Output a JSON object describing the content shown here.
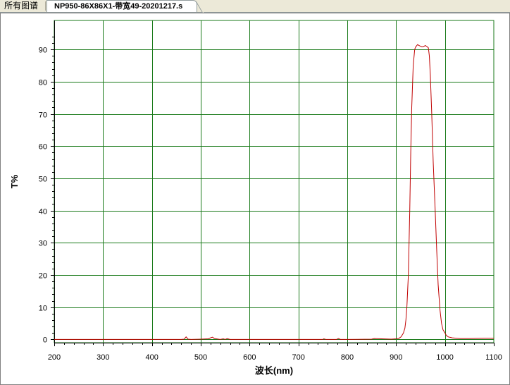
{
  "tabs": {
    "all_spectra": "所有图谱",
    "current_file": "NP950-86X86X1-带宽49-20201217.s"
  },
  "colors": {
    "plot_bg": "#ffffff",
    "grid": "#1a7a1a",
    "curve": "#c00000"
  },
  "chart_data": {
    "type": "line",
    "xlabel": "波长(nm)",
    "ylabel": "T%",
    "xlim": [
      200,
      1100
    ],
    "ylim": [
      -1,
      99
    ],
    "xticks": [
      200,
      300,
      400,
      500,
      600,
      700,
      800,
      900,
      1000,
      1100
    ],
    "yticks": [
      0,
      10,
      20,
      30,
      40,
      50,
      60,
      70,
      80,
      90
    ],
    "grid": true,
    "series": [
      {
        "x": [
          200,
          300,
          400,
          460,
          466,
          470,
          474,
          480,
          500,
          516,
          520,
          524,
          528,
          540,
          546,
          550,
          554,
          560,
          600,
          700,
          750,
          752,
          756,
          760,
          778,
          782,
          786,
          800,
          850,
          855,
          870,
          890,
          900,
          905,
          910,
          915,
          918,
          920,
          922,
          925,
          928,
          930,
          932,
          935,
          938,
          940,
          944,
          947,
          950,
          953,
          956,
          960,
          963,
          966,
          968,
          970,
          973,
          976,
          980,
          983,
          986,
          990,
          993,
          996,
          1000,
          1003,
          1007,
          1015,
          1030,
          1050,
          1080,
          1100
        ],
        "y": [
          0,
          0,
          0,
          0,
          0.1,
          0.8,
          0.1,
          0,
          0.1,
          0.2,
          0.5,
          0.7,
          0.3,
          0,
          0.2,
          0,
          0.3,
          0,
          0,
          0,
          0,
          0.2,
          0,
          0,
          0,
          0.3,
          0,
          0,
          0.1,
          0.3,
          0.2,
          0.1,
          0.2,
          0.3,
          0.8,
          2.0,
          3.5,
          6,
          10,
          20,
          40,
          58,
          72,
          85,
          90,
          90.8,
          91.5,
          91.2,
          91,
          90.8,
          90.9,
          91.2,
          90.9,
          90.5,
          88,
          82,
          70,
          55,
          40,
          28,
          17,
          9,
          5,
          3,
          2,
          1.2,
          0.8,
          0.5,
          0.3,
          0.3,
          0.4,
          0.4
        ]
      }
    ]
  }
}
